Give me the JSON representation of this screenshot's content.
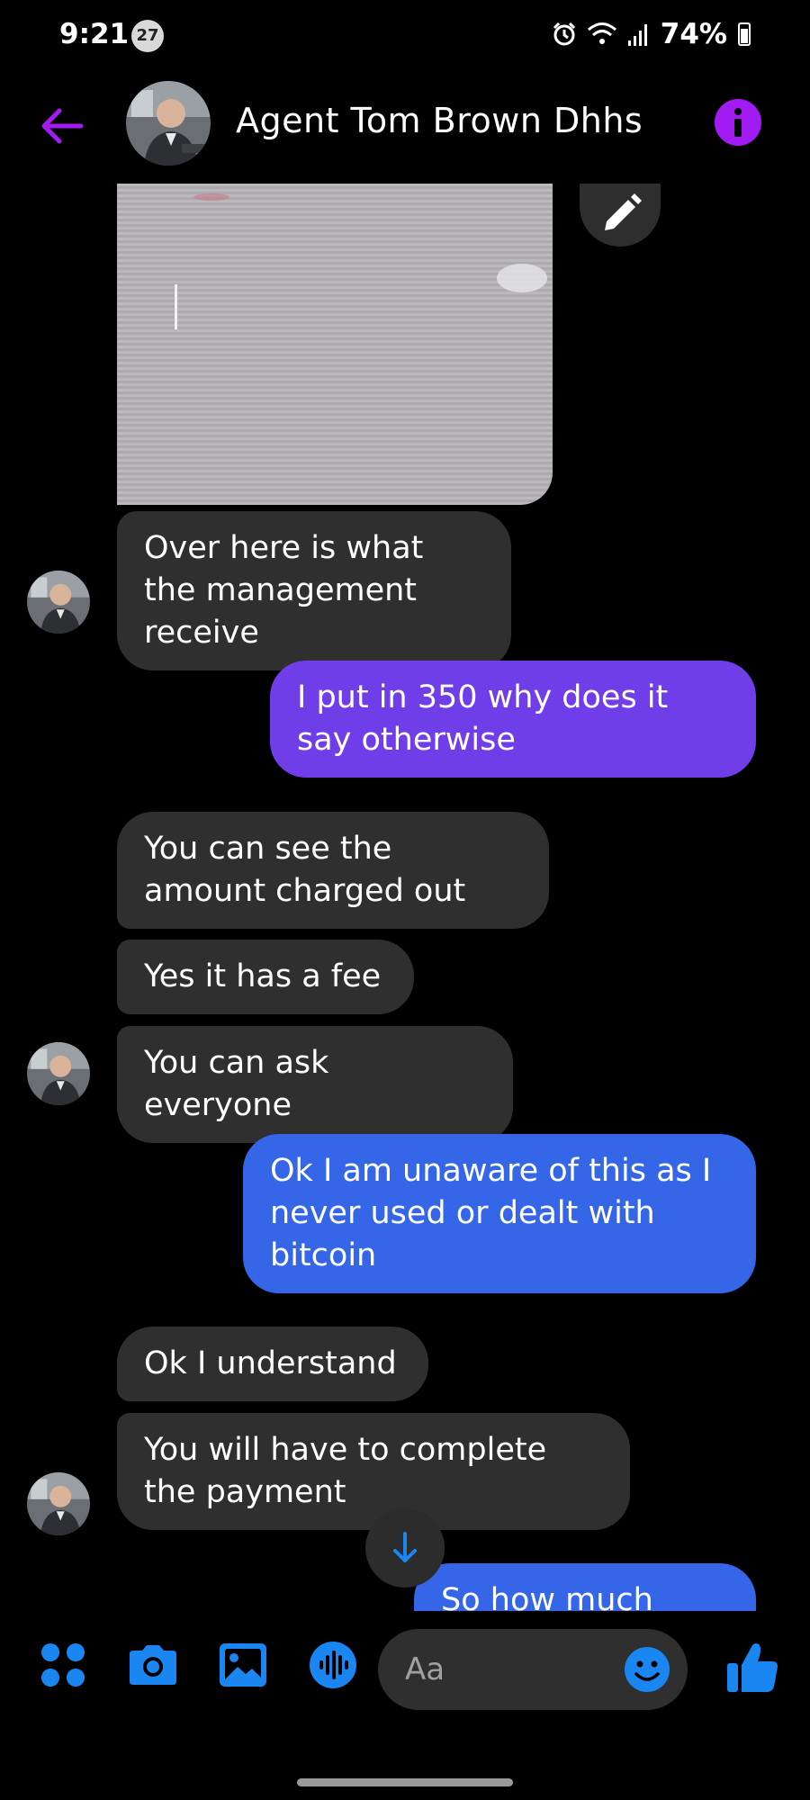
{
  "status_bar": {
    "time": "9:21",
    "notification_count": "27",
    "battery": "74%"
  },
  "header": {
    "contact_name": "Agent Tom Brown Dhhs"
  },
  "messages": [
    {
      "direction": "incoming",
      "text": "Over here is what the management receive"
    },
    {
      "direction": "outgoing",
      "text": "I put in 350 why does it say otherwise"
    },
    {
      "direction": "incoming",
      "text": "You can see the amount charged out"
    },
    {
      "direction": "incoming",
      "text": "Yes it has a fee"
    },
    {
      "direction": "incoming",
      "text": "You can ask everyone"
    },
    {
      "direction": "outgoing",
      "text": "Ok I am unaware of this as I never used or dealt with bitcoin"
    },
    {
      "direction": "incoming",
      "text": "Ok I understand"
    },
    {
      "direction": "incoming",
      "text": "You will have to complete the payment"
    },
    {
      "direction": "outgoing",
      "text": "So how much more"
    }
  ],
  "composer": {
    "placeholder": "Aa"
  },
  "colors": {
    "accent": "#a21bf2",
    "outgoing_purple": "#6f3ee8",
    "outgoing_blue": "#3566e8",
    "incoming": "#2f2f2f",
    "icon_blue": "#1a86f2"
  },
  "icons": {
    "back": "arrow-left-icon",
    "info": "info-icon",
    "edit": "pencil-icon",
    "scroll": "arrow-down-icon",
    "menu": "grid-dots-icon",
    "camera": "camera-icon",
    "gallery": "image-icon",
    "voice": "microphone-wave-icon",
    "emoji": "emoji-icon",
    "like": "thumbs-up-icon"
  }
}
